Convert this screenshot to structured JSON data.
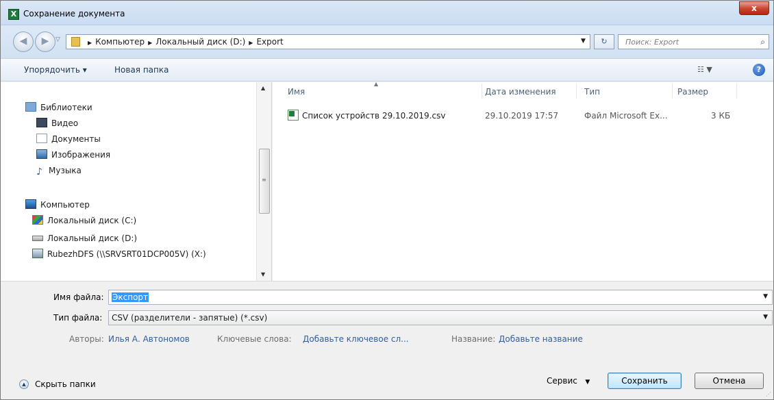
{
  "window": {
    "title": "Сохранение документа",
    "app_icon": "excel-icon",
    "close_label": "x"
  },
  "address": {
    "crumbs": [
      "Компьютер",
      "Локальный диск (D:)",
      "Export"
    ],
    "search_placeholder": "Поиск: Export"
  },
  "toolbar": {
    "organize_label": "Упорядочить ▾",
    "new_folder_label": "Новая папка"
  },
  "nav": {
    "libraries": {
      "label": "Библиотеки",
      "icon": "libraries-icon"
    },
    "library_items": [
      {
        "label": "Видео",
        "icon": "video-icon"
      },
      {
        "label": "Документы",
        "icon": "documents-icon"
      },
      {
        "label": "Изображения",
        "icon": "images-icon"
      },
      {
        "label": "Музыка",
        "icon": "music-icon"
      }
    ],
    "computer": {
      "label": "Компьютер",
      "icon": "computer-icon"
    },
    "drives": [
      {
        "label": "Локальный диск (C:)",
        "icon": "system-drive-icon"
      },
      {
        "label": "Локальный диск (D:)",
        "icon": "drive-icon",
        "selected": true
      },
      {
        "label": "RubezhDFS (\\\\SRVSRT01DCP005V) (X:)",
        "icon": "network-drive-icon"
      }
    ]
  },
  "columns": {
    "name": "Имя",
    "modified": "Дата изменения",
    "type": "Тип",
    "size": "Размер"
  },
  "files": [
    {
      "name": "Список устройств 29.10.2019.csv",
      "modified": "29.10.2019 17:57",
      "type": "Файл Microsoft Ex...",
      "size": "3 КБ",
      "icon": "csv-file-icon"
    }
  ],
  "form": {
    "filename_label": "Имя файла:",
    "filename_value": "Экспорт",
    "filetype_label": "Тип файла:",
    "filetype_value": "CSV (разделители - запятые) (*.csv)",
    "authors_label": "Авторы:",
    "authors_value": "Илья А. Автономов",
    "keywords_label": "Ключевые слова:",
    "keywords_value": "Добавьте ключевое сл...",
    "title_label": "Название:",
    "title_value": "Добавьте название"
  },
  "footer": {
    "hide_folders_label": "Скрыть папки",
    "service_label": "Сервис",
    "save_label": "Сохранить",
    "cancel_label": "Отмена"
  },
  "colors": {
    "selection": "#3399ff",
    "link": "#2e5ea3",
    "close": "#c8442c"
  }
}
